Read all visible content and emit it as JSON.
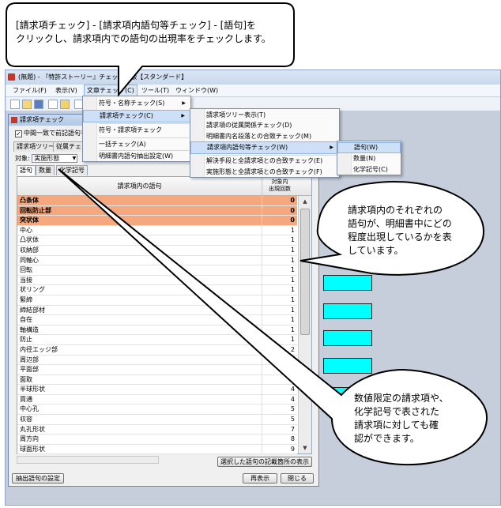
{
  "app": {
    "title": "(無題) - 『特許ストーリー』チェッカー版【スタンダード】",
    "menus": [
      "ファイル(F)",
      "表示(V)",
      "文章チェック(C)",
      "ツール(T)",
      "ウィンドウ(W)"
    ]
  },
  "menu_level1": {
    "items": [
      "符号・名称チェック(S)",
      "請求項チェック(C)",
      "符号・請求項チェック",
      "一括チェック(A)",
      "明細書内語句抽出設定(W)"
    ]
  },
  "menu_level2": {
    "items": [
      "請求項ツリー表示(T)",
      "請求項の従属関係チェック(D)",
      "明細書内名段落との合致チェック(M)",
      "請求項内語句等チェック(W)",
      "解決手段と全請求項との合致チェック(E)",
      "実施形態と全請求項との合致チェック(F)"
    ]
  },
  "menu_level3": {
    "items": [
      "語句(W)",
      "数量(N)",
      "化学記号(C)"
    ]
  },
  "checker": {
    "title": "請求項チェック",
    "checkbox_label": "中間一致で前記語句を",
    "tabs": [
      "請求項ツリー",
      "従属チェック"
    ],
    "target_label": "対象:",
    "target_value": "実施形態",
    "subtabs": [
      "語句",
      "数量",
      "化学記号"
    ],
    "col_term": "請求項内の語句",
    "col_count_line1": "対象内",
    "col_count_line2": "出現回数",
    "rows": [
      {
        "term": "凸条体",
        "count": "0",
        "hl": true
      },
      {
        "term": "回転防止部",
        "count": "0",
        "hl": true
      },
      {
        "term": "突状体",
        "count": "0",
        "hl": true
      },
      {
        "term": "中心",
        "count": "1",
        "hl": false
      },
      {
        "term": "凸状体",
        "count": "1",
        "hl": false
      },
      {
        "term": "収納部",
        "count": "1",
        "hl": false
      },
      {
        "term": "同軸心",
        "count": "1",
        "hl": false
      },
      {
        "term": "回転",
        "count": "1",
        "hl": false
      },
      {
        "term": "当接",
        "count": "1",
        "hl": false
      },
      {
        "term": "状リング",
        "count": "1",
        "hl": false
      },
      {
        "term": "緊締",
        "count": "1",
        "hl": false
      },
      {
        "term": "締結部材",
        "count": "1",
        "hl": false
      },
      {
        "term": "自在",
        "count": "1",
        "hl": false
      },
      {
        "term": "軸構造",
        "count": "1",
        "hl": false
      },
      {
        "term": "防止",
        "count": "1",
        "hl": false
      },
      {
        "term": "内径エッジ部",
        "count": "2",
        "hl": false
      },
      {
        "term": "周辺部",
        "count": "2",
        "hl": false
      },
      {
        "term": "平面部",
        "count": "2",
        "hl": false
      },
      {
        "term": "面取",
        "count": "2",
        "hl": false
      },
      {
        "term": "半球形状",
        "count": "4",
        "hl": false
      },
      {
        "term": "貫通",
        "count": "4",
        "hl": false
      },
      {
        "term": "中心孔",
        "count": "5",
        "hl": false
      },
      {
        "term": "収容",
        "count": "5",
        "hl": false
      },
      {
        "term": "丸孔形状",
        "count": "7",
        "hl": false
      },
      {
        "term": "周方向",
        "count": "8",
        "hl": false
      },
      {
        "term": "球面形状",
        "count": "9",
        "hl": false
      }
    ],
    "btn_show_locations": "選択した語句の記載箇所の表示",
    "btn_extract_settings": "抽出語句の設定",
    "btn_redisplay": "再表示",
    "btn_close": "閉じる"
  },
  "callouts": {
    "top_line1": "[請求項チェック] - [請求項内語句等チェック] - [語句]を",
    "top_line2": "クリックし、請求項内での語句の出現率をチェックします。",
    "mid_lines": [
      "請求項内のそれぞれの",
      "語句が、明細書中にどの",
      "程度出現しているかを表",
      "しています。"
    ],
    "bottom_lines": [
      "数値限定の請求項や、",
      "化学記号で表された",
      "請求項に対しても確",
      "認ができます。"
    ]
  },
  "colors": {
    "highlight": "#f5a77d",
    "cyan_bar": "#00ffff"
  }
}
